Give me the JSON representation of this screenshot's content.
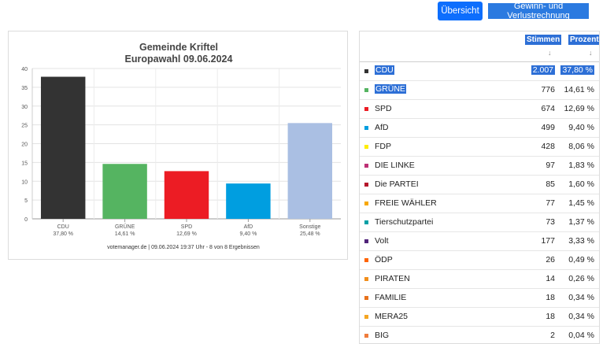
{
  "toolbar": {
    "overview_label": "Übersicht",
    "profit_loss_label": "Gewinn- und Verlustrechnung"
  },
  "chart_data": {
    "type": "bar",
    "title": "Gemeinde Kriftel",
    "subtitle": "Europawahl 09.06.2024",
    "categories": [
      "CDU",
      "GRÜNE",
      "SPD",
      "AfD",
      "Sonstige"
    ],
    "value_labels": [
      "37,80 %",
      "14,61 %",
      "12,69 %",
      "9,40 %",
      "25,48 %"
    ],
    "values": [
      37.8,
      14.61,
      12.69,
      9.4,
      25.48
    ],
    "colors": [
      "#333333",
      "#55b461",
      "#ec1c24",
      "#009ee0",
      "#aabfe3"
    ],
    "ylim": [
      0,
      40
    ],
    "yticks": [
      0,
      5,
      10,
      15,
      20,
      25,
      30,
      35,
      40
    ],
    "grid": true,
    "footer": "votemanager.de | 09.06.2024 19:37 Uhr - 8 von 8 Ergebnissen"
  },
  "table": {
    "headers": {
      "votes": "Stimmen",
      "percent": "Prozent"
    },
    "sort_arrow": "↓",
    "rows": [
      {
        "party": "CDU",
        "votes": "2.007",
        "percent": "37,80 %",
        "color": "#333333"
      },
      {
        "party": "GRÜNE",
        "votes": "776",
        "percent": "14,61 %",
        "color": "#55b461"
      },
      {
        "party": "SPD",
        "votes": "674",
        "percent": "12,69 %",
        "color": "#ec1c24"
      },
      {
        "party": "AfD",
        "votes": "499",
        "percent": "9,40 %",
        "color": "#009ee0"
      },
      {
        "party": "FDP",
        "votes": "428",
        "percent": "8,06 %",
        "color": "#ffed00"
      },
      {
        "party": "DIE LINKE",
        "votes": "97",
        "percent": "1,83 %",
        "color": "#be3075"
      },
      {
        "party": "Die PARTEI",
        "votes": "85",
        "percent": "1,60 %",
        "color": "#b5152b"
      },
      {
        "party": "FREIE WÄHLER",
        "votes": "77",
        "percent": "1,45 %",
        "color": "#f7a800"
      },
      {
        "party": "Tierschutzpartei",
        "votes": "73",
        "percent": "1,37 %",
        "color": "#00a0a5"
      },
      {
        "party": "Volt",
        "votes": "177",
        "percent": "3,33 %",
        "color": "#502379"
      },
      {
        "party": "ÖDP",
        "votes": "26",
        "percent": "0,49 %",
        "color": "#ff6400"
      },
      {
        "party": "PIRATEN",
        "votes": "14",
        "percent": "0,26 %",
        "color": "#f28e1c"
      },
      {
        "party": "FAMILIE",
        "votes": "18",
        "percent": "0,34 %",
        "color": "#e8721c"
      },
      {
        "party": "MERA25",
        "votes": "18",
        "percent": "0,34 %",
        "color": "#f5a623"
      },
      {
        "party": "BIG",
        "votes": "2",
        "percent": "0,04 %",
        "color": "#f07c3c"
      }
    ]
  }
}
